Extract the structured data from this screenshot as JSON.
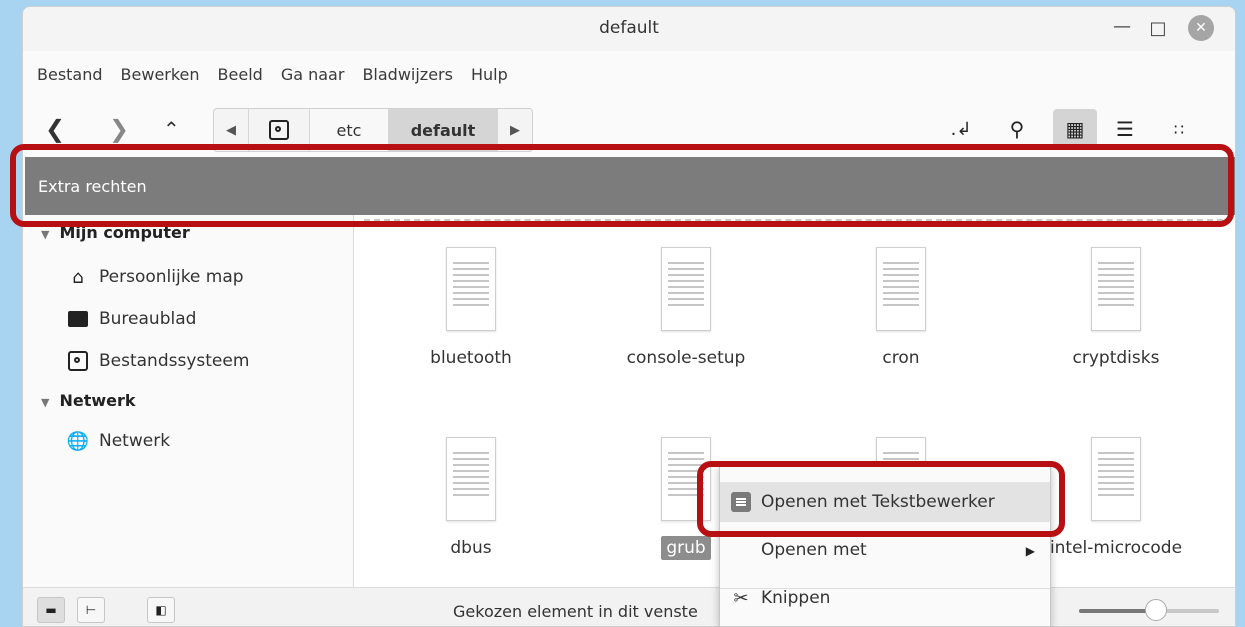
{
  "window": {
    "title": "default",
    "minimize_icon": "minimize-icon",
    "maximize_icon": "maximize-icon",
    "close_icon": "close-icon"
  },
  "menubar": [
    "Bestand",
    "Bewerken",
    "Beeld",
    "Ga naar",
    "Bladwijzers",
    "Hulp"
  ],
  "toolbar": {
    "breadcrumb": [
      "etc",
      "default"
    ],
    "icons": [
      "back-icon",
      "forward-icon",
      "up-icon",
      "toggle-location-icon",
      "search-icon",
      "icon-view-icon",
      "list-view-icon",
      "compact-view-icon"
    ]
  },
  "permission_bar": {
    "text": "Extra rechten"
  },
  "sidebar": {
    "sections": [
      {
        "title": "Mijn computer",
        "items": [
          "Persoonlijke map",
          "Bureaublad",
          "Bestandssysteem"
        ]
      },
      {
        "title": "Netwerk",
        "items": [
          "Netwerk"
        ]
      }
    ]
  },
  "files": [
    "bluetooth",
    "console-setup",
    "cron",
    "cryptdisks",
    "dbus",
    "grub",
    "",
    "intel-microcode"
  ],
  "selected_file": "grub",
  "context_menu": {
    "items": [
      "Openen met Tekstbewerker",
      "Openen met",
      "Knippen"
    ]
  },
  "statusbar": {
    "text": "Gekozen element in dit venste",
    "zoom": 0.55
  },
  "colors": {
    "highlight_red": "#b80f12",
    "permission_bar": "#7c7c7c"
  }
}
